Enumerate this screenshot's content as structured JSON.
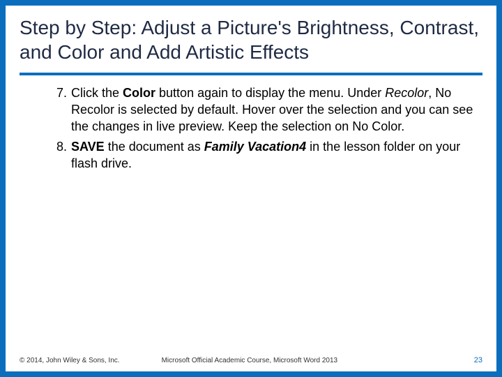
{
  "title": "Step by Step: Adjust a Picture's Brightness, Contrast, and Color and Add Artistic Effects",
  "steps": [
    {
      "n": "7.",
      "segments": [
        {
          "t": "Click the "
        },
        {
          "t": "Color",
          "cls": "b"
        },
        {
          "t": " button again to display the menu. Under "
        },
        {
          "t": "Recolor",
          "cls": "i"
        },
        {
          "t": ", No Recolor is selected by default. Hover over the selection and you can see the changes in live preview. Keep the selection on No Color."
        }
      ]
    },
    {
      "n": "8.",
      "segments": [
        {
          "t": " "
        },
        {
          "t": "SAVE",
          "cls": "b"
        },
        {
          "t": " the document as "
        },
        {
          "t": "Family Vacation4",
          "cls": "bi"
        },
        {
          "t": " in the lesson folder on your flash drive."
        }
      ]
    }
  ],
  "footer": {
    "copyright": "© 2014, John Wiley & Sons, Inc.",
    "course": "Microsoft Official Academic Course, Microsoft Word 2013",
    "page": "23"
  }
}
